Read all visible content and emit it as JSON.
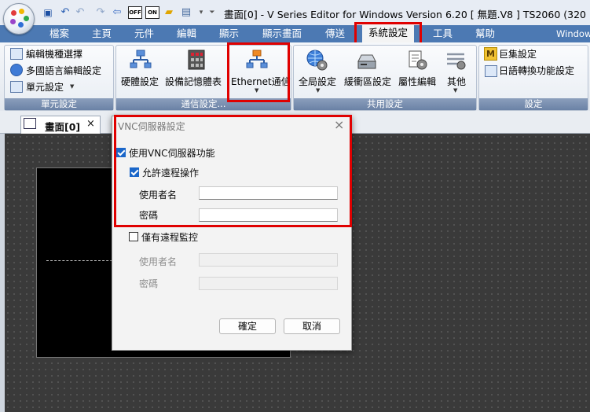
{
  "window": {
    "title": "畫面[0] - V Series Editor for Windows Version 6.20 [ 無題.V8 ] TS2060 (320 ..."
  },
  "quick_access": {
    "off_label": "OFF",
    "on_label": "ON"
  },
  "menu": {
    "items": [
      "檔案",
      "主頁",
      "元件",
      "編輯",
      "顯示",
      "顯示畫面",
      "傳送",
      "系統設定",
      "工具",
      "幫助"
    ],
    "overflow": "Window",
    "active": "系統設定"
  },
  "ribbon": {
    "unit": {
      "label": "單元設定",
      "items": [
        "編輯機種選擇",
        "多國語言編輯設定",
        "單元設定"
      ]
    },
    "comm": {
      "label": "通信設定...",
      "hardware": "硬體設定",
      "device_memory": "設備記憶體表",
      "ethernet": "Ethernet通信"
    },
    "common": {
      "label": "共用設定",
      "global": "全局設定",
      "buffer": "緩衝區設定",
      "attr": "屬性編輯",
      "other": "其他"
    },
    "settings": {
      "label": "設定",
      "macro": "巨集設定",
      "jp_convert": "日語轉換功能設定",
      "macro_icon": "M"
    }
  },
  "doc_tab": {
    "label": "畫面[0]",
    "close": "×"
  },
  "dialog": {
    "title": "VNC伺服器設定",
    "close": "×",
    "use_vnc": {
      "label": "使用VNC伺服器功能",
      "checked": true
    },
    "allow_remote": {
      "label": "允許遠程操作",
      "checked": true
    },
    "username_label": "使用者名",
    "username_value": "",
    "password_label": "密碼",
    "password_value": "",
    "monitor_only": {
      "label": "僅有遠程監控",
      "checked": false
    },
    "monitor_username_label": "使用者名",
    "monitor_username_value": "",
    "monitor_password_label": "密碼",
    "monitor_password_value": "",
    "ok": "確定",
    "cancel": "取消"
  },
  "colors": {
    "menubar": "#4c79b3",
    "highlight": "#e00000",
    "check": "#1a66c9"
  }
}
